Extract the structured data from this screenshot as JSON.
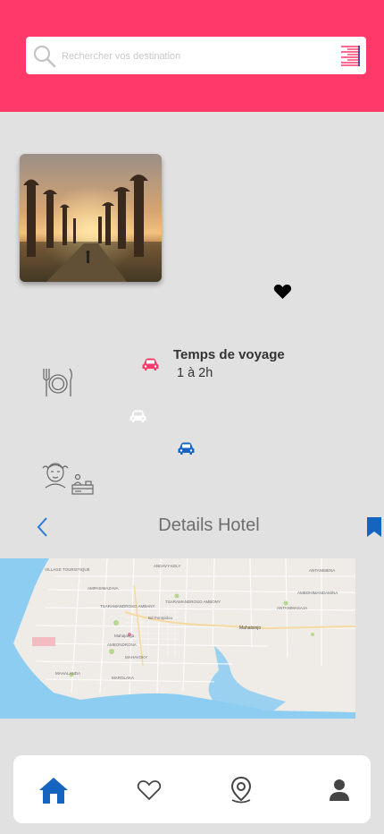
{
  "search": {
    "placeholder": "Rechercher vos destination"
  },
  "icons": {
    "search": "search-icon",
    "menu": "align-right-icon",
    "favorite": "heart-icon",
    "restaurant": "restaurant-icon",
    "spa": "spa-icon",
    "reception": "reception-icon",
    "car": "car-icon",
    "back": "chevron-left-icon",
    "bookmark": "bookmark-icon"
  },
  "travel": {
    "title": "Temps de voyage",
    "value": "1 à 2h"
  },
  "details": {
    "title": "Details Hotel"
  },
  "map": {
    "labels": [
      "VILLAGE TOURISTIQUE",
      "ANDAVY-KELY",
      "AMPASIMAZAVA",
      "TSARAMANDROSO AMBANY",
      "TSARAMANDROSO AMBONY",
      "AMBONDRONA",
      "MAHAVOKY",
      "MAROLAKA",
      "MAHALANDA",
      "Mahatsinjo",
      "ANTANIMENA",
      "AMBOHIMANDAMINA",
      "ANTANIMASAJA",
      "Bd Pompidou",
      "Mahajanga"
    ]
  },
  "nav": {
    "items": [
      "home-icon",
      "heart-outline-icon",
      "map-pin-icon",
      "user-icon"
    ],
    "active": "home-icon"
  },
  "colors": {
    "header": "#ff3a6b",
    "background": "#e1e1e1",
    "active_blue": "#1565c0",
    "pink_accent": "#ff3a6b",
    "back_blue": "#2a7bd6",
    "water": "#8ccdf1"
  }
}
